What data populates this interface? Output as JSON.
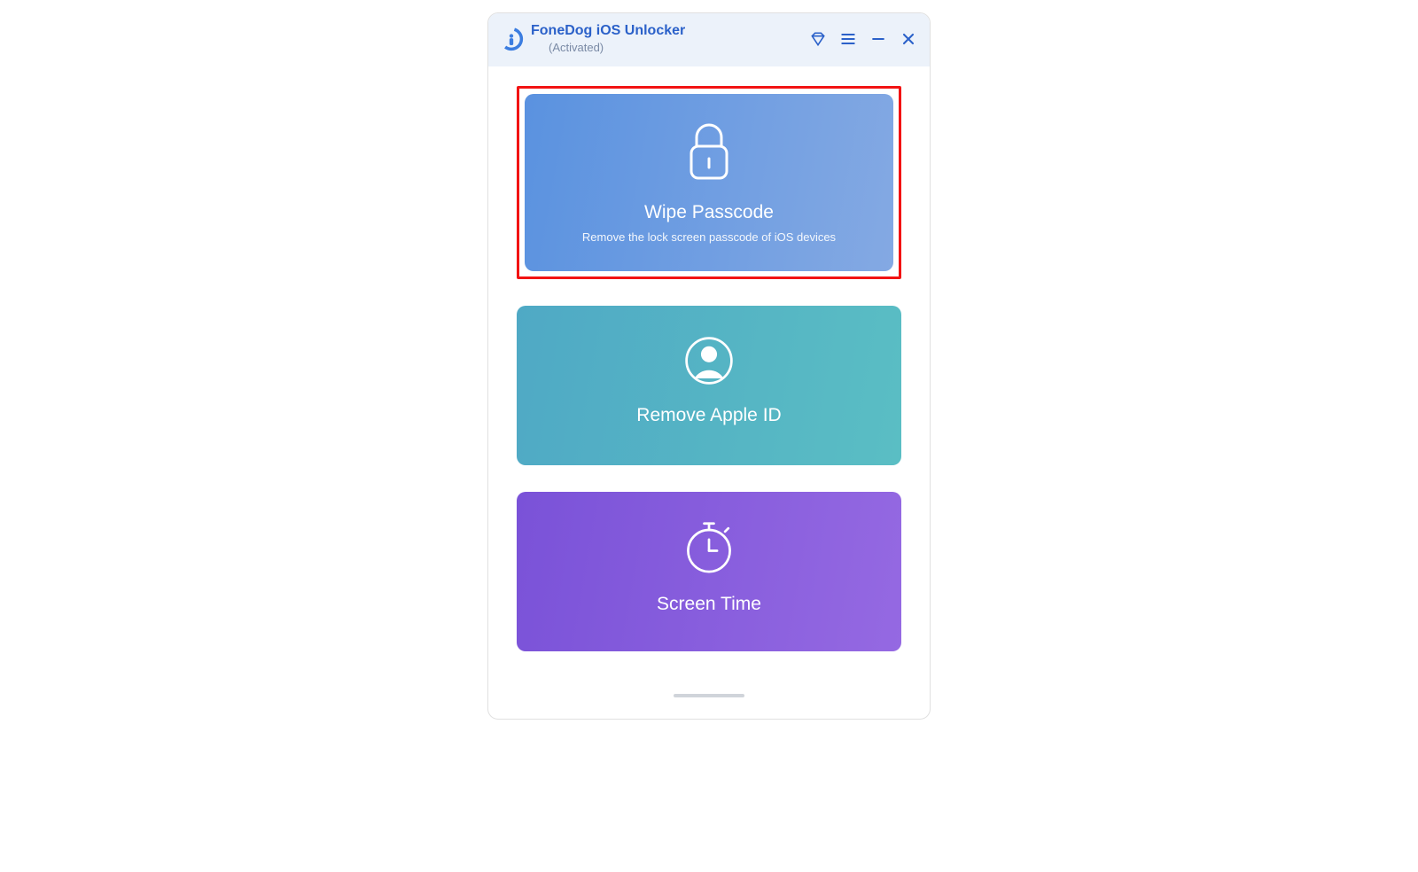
{
  "app": {
    "title": "FoneDog iOS Unlocker",
    "status": "(Activated)"
  },
  "cards": {
    "wipe": {
      "title": "Wipe Passcode",
      "subtitle": "Remove the lock screen passcode of iOS devices"
    },
    "appleid": {
      "title": "Remove Apple ID"
    },
    "screentime": {
      "title": "Screen Time"
    }
  }
}
